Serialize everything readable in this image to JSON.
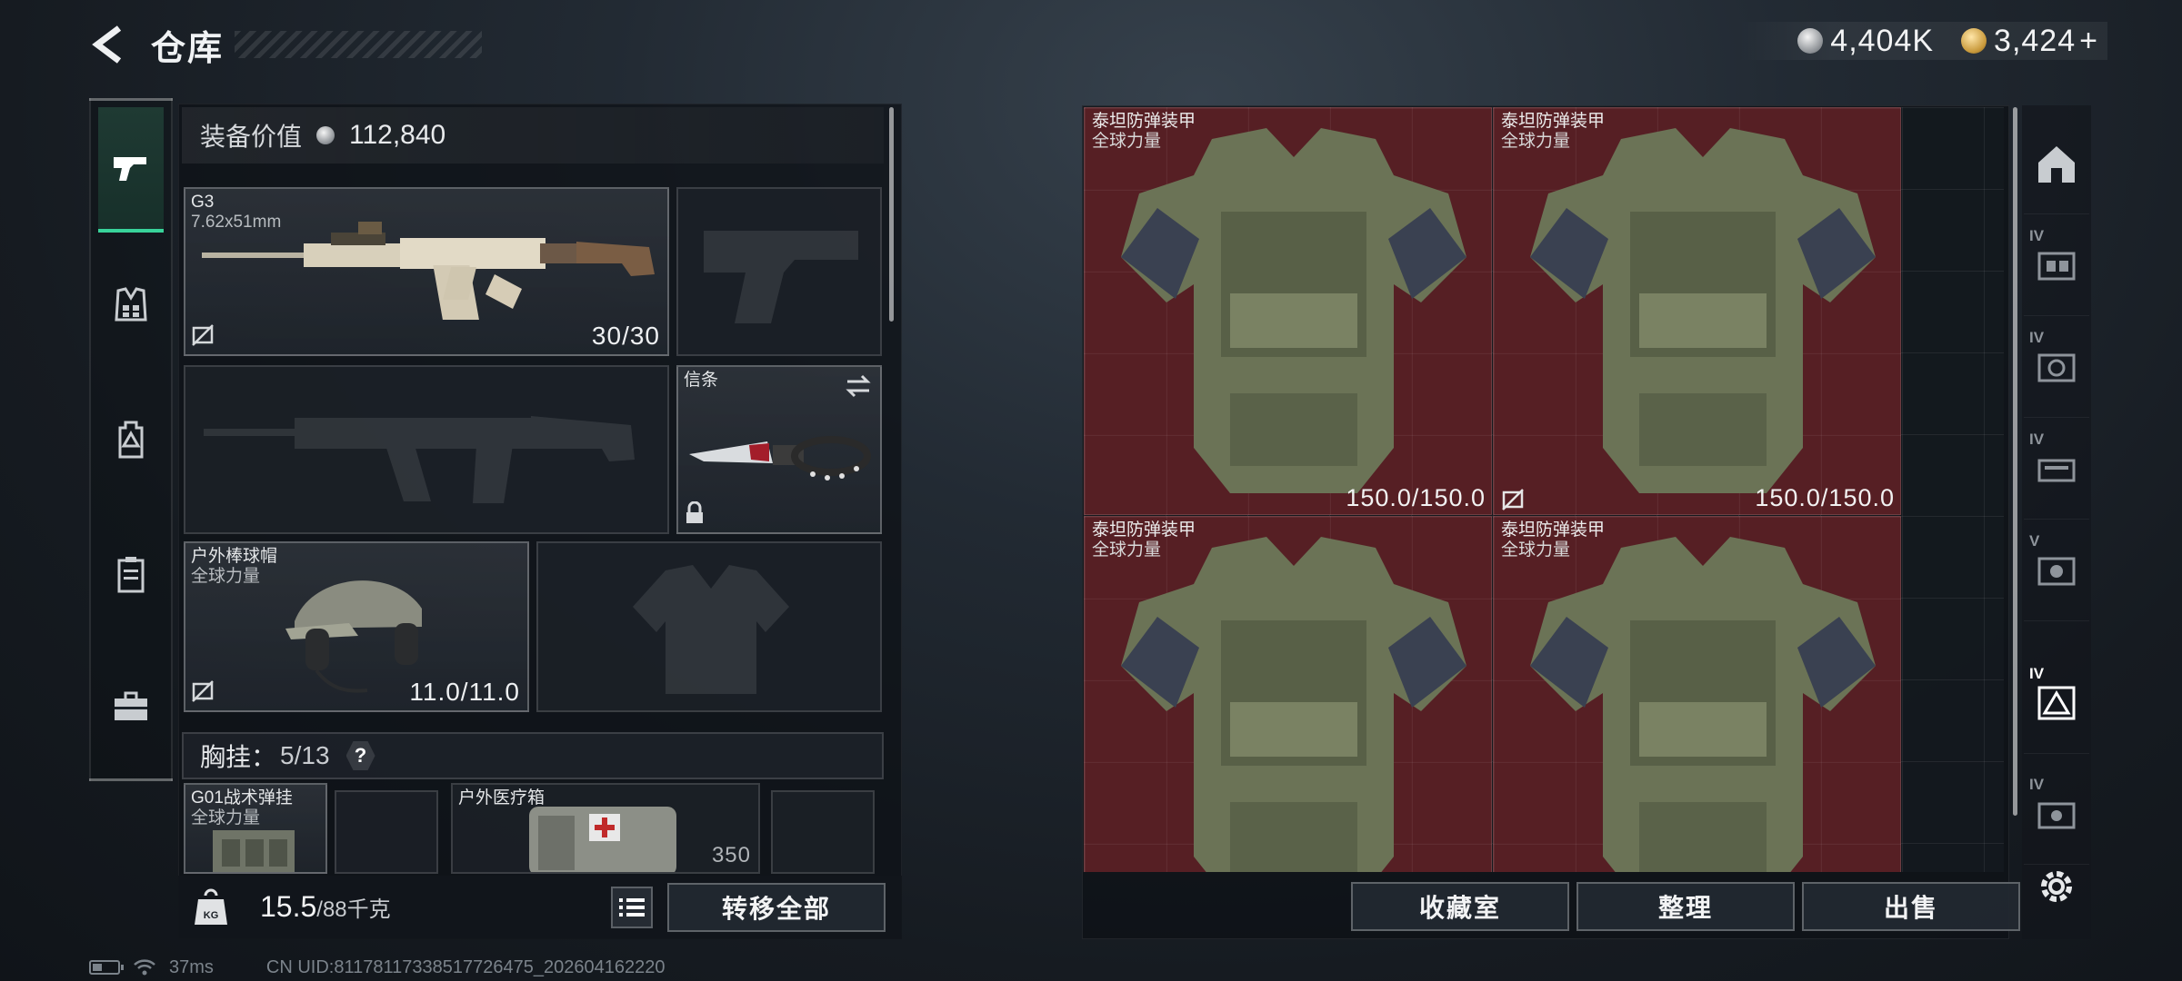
{
  "header": {
    "title": "仓库",
    "currency": [
      {
        "value": "4,404K",
        "icon": "silver-coin-icon"
      },
      {
        "value": "3,424",
        "icon": "gold-coin-icon",
        "add": "+"
      }
    ]
  },
  "equipment": {
    "label": "装备价值",
    "value": "112,840",
    "primary_weapon": {
      "name": "G3",
      "caliber": "7.62x51mm",
      "ammo": "30/30"
    },
    "melee": {
      "name": "信条"
    },
    "helmet": {
      "name": "户外棒球帽",
      "tag": "全球力量",
      "durability": "11.0/11.0"
    },
    "chest_rig": {
      "label": "胸挂：",
      "value": "5/13",
      "help": "?"
    },
    "rig_slot": {
      "name": "G01战术弹挂",
      "tag": "全球力量"
    },
    "medkit_slot": {
      "name": "户外医疗箱",
      "count": "350"
    }
  },
  "left_bottom": {
    "weight_value": "15.5",
    "weight_capacity": "/88千克",
    "transfer_all_label": "转移全部"
  },
  "storage": {
    "items": [
      {
        "name": "泰坦防弹装甲",
        "tag": "全球力量",
        "durability": "150.0/150.0"
      },
      {
        "name": "泰坦防弹装甲",
        "tag": "全球力量",
        "durability": "150.0/150.0"
      },
      {
        "name": "泰坦防弹装甲",
        "tag": "全球力量",
        "durability": ""
      },
      {
        "name": "泰坦防弹装甲",
        "tag": "全球力量",
        "durability": ""
      }
    ],
    "buttons": {
      "collection": "收藏室",
      "organize": "整理",
      "sell": "出售"
    }
  },
  "side_tabs": [
    {
      "tier": "",
      "icon": "home-storage-icon"
    },
    {
      "tier": "IV",
      "icon": "storage-tier-icon"
    },
    {
      "tier": "IV",
      "icon": "storage-tier-icon"
    },
    {
      "tier": "IV",
      "icon": "storage-tier-icon"
    },
    {
      "tier": "V",
      "icon": "storage-tier-icon"
    },
    {
      "tier": "IV",
      "icon": "armor-storage-icon"
    },
    {
      "tier": "IV",
      "icon": "storage-tier-icon"
    }
  ],
  "status": {
    "ping": "37ms",
    "uid": "CN UID:8117811733851772647​5_202604162220"
  },
  "colors": {
    "accent_green": "#38d39a",
    "armor_cell_red": "#602026"
  }
}
